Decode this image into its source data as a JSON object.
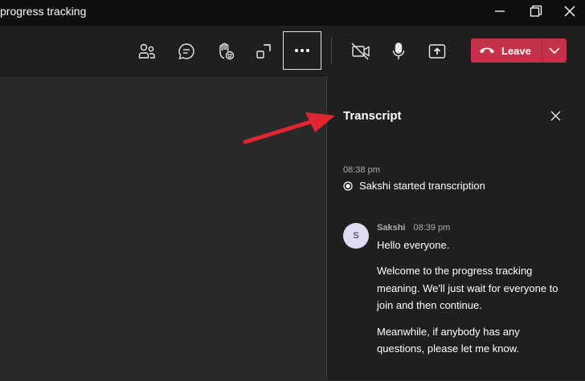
{
  "window": {
    "title": "progress tracking"
  },
  "toolbar": {
    "buttons": [
      {
        "name": "participants-icon"
      },
      {
        "name": "chat-icon"
      },
      {
        "name": "raise-hand-icon"
      },
      {
        "name": "share-tray-icon"
      },
      {
        "name": "more-actions-icon"
      },
      {
        "name": "camera-off-icon"
      },
      {
        "name": "microphone-icon"
      },
      {
        "name": "share-screen-icon"
      }
    ],
    "leave_label": "Leave"
  },
  "colors": {
    "leave_button": "#c4314b",
    "panel_bg": "#1f1f1f",
    "stage_bg": "#292929",
    "annotation_arrow": "#e02630"
  },
  "transcript": {
    "title": "Transcript",
    "system_time": "08:38 pm",
    "system_event": "Sakshi started transcription",
    "message": {
      "avatar_initial": "S",
      "author": "Sakshi",
      "time": "08:39 pm",
      "lines": [
        "Hello everyone.",
        "Welcome to the progress tracking meaning. We'll just wait for everyone to join and then continue.",
        "Meanwhile, if anybody has any questions, please let me know."
      ]
    }
  }
}
